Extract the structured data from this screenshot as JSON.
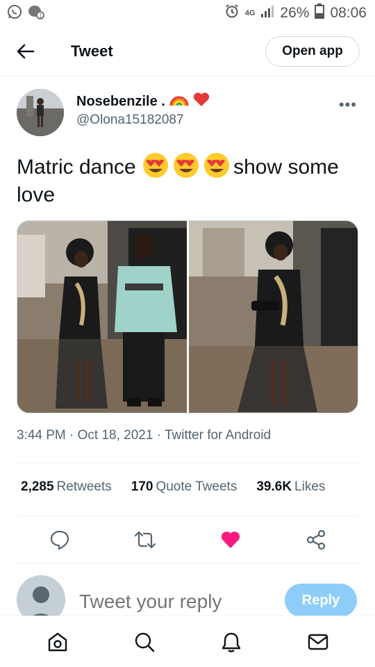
{
  "status_bar": {
    "network": "4G",
    "battery": "26%",
    "time": "08:06",
    "left_icons": [
      "whatsapp-icon",
      "chat-bubble-icon"
    ],
    "right_icons": [
      "alarm-icon",
      "signal-icon",
      "battery-icon"
    ]
  },
  "header": {
    "title": "Tweet",
    "open_app_label": "Open app"
  },
  "tweet": {
    "author_name": "Nosebenzile .",
    "author_handle": "@Olona15182087",
    "text_before": "Matric dance",
    "text_after": "show some love",
    "emoji": "heart-eyes-emoji",
    "timestamp": "3:44 PM · Oct 18, 2021 · Twitter for Android"
  },
  "stats": {
    "retweets_count": "2,285",
    "retweets_label": "Retweets",
    "quotes_count": "170",
    "quotes_label": "Quote Tweets",
    "likes_count": "39.6K",
    "likes_label": "Likes"
  },
  "reply": {
    "placeholder": "Tweet your reply",
    "button_label": "Reply"
  },
  "colors": {
    "like_active": "#f91880",
    "reply_button": "#8ecdf8",
    "secondary_text": "#536471"
  }
}
